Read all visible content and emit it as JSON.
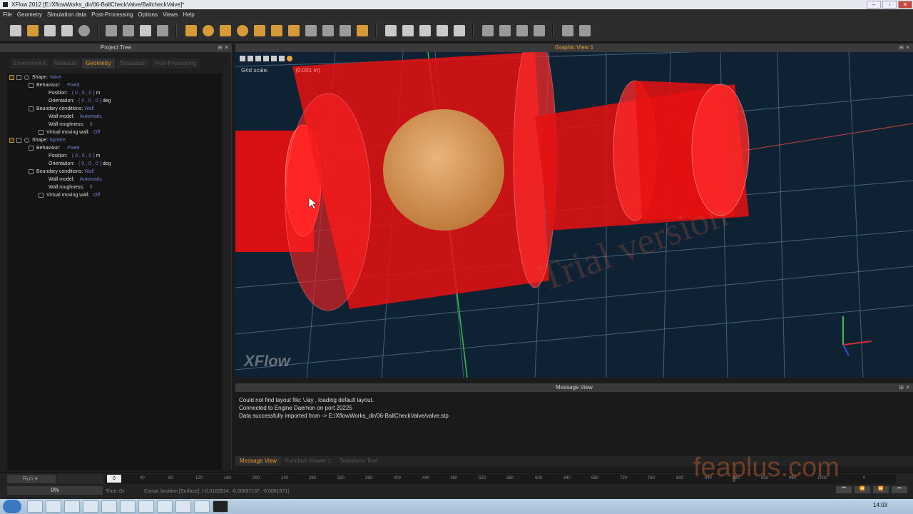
{
  "window": {
    "title": "XFlow 2012 [E:/XflowWorks_dir/06-BallCheckValve/BallcheckValve]*"
  },
  "menu": [
    "File",
    "Geometry",
    "Simulation data",
    "Post-Processing",
    "Options",
    "Views",
    "Help"
  ],
  "project_tree": {
    "title": "Project Tree",
    "tabs": [
      "Environment",
      "Materials",
      "Geometry",
      "Simulation",
      "Post-Processing"
    ],
    "active_tab": "Geometry",
    "shape1": {
      "label": "Shape:",
      "name": "Valve",
      "behaviour_label": "Behaviour:",
      "behaviour": "Fixed",
      "position_label": "Position:",
      "position": "( 0 , 0 , 0 )",
      "position_unit": "m",
      "orientation_label": "Orientation:",
      "orientation": "( 0 , 0 , 0 )",
      "orientation_unit": "deg",
      "bc_label": "Boundary conditions:",
      "bc": "Wall",
      "wall_model_label": "Wall model:",
      "wall_model": "Automatic",
      "wall_rough_label": "Wall roughness:",
      "wall_rough": "0",
      "vmw_label": "Virtual moving wall:",
      "vmw": "Off"
    },
    "shape2": {
      "label": "Shape:",
      "name": "Sphere",
      "behaviour_label": "Behaviour:",
      "behaviour": "Fixed",
      "position_label": "Position:",
      "position": "( 0 , 0 , 0 )",
      "position_unit": "m",
      "orientation_label": "Orientation:",
      "orientation": "( 0 , 0 , 0 )",
      "orientation_unit": "deg",
      "bc_label": "Boundary conditions:",
      "bc": "Wall",
      "wall_model_label": "Wall model:",
      "wall_model": "Automatic",
      "wall_rough_label": "Wall roughness:",
      "wall_rough": "0",
      "vmw_label": "Virtual moving wall:",
      "vmw": "Off"
    }
  },
  "graphic_view": {
    "title": "Graphic View 1",
    "grid_scale_label": "Grid scale:",
    "grid_scale_value": "(0.001 m)",
    "watermark": "Trial version",
    "logo": "XFlow"
  },
  "message_view": {
    "title": "Message View",
    "lines": [
      "Could not find layout file: \\.lay , loading default layout.",
      "Connected to Engine Daemon on port 20225",
      "Data successfully imported from -> E:/XflowWorks_dir/06-BallCheckValve/valve.stp"
    ],
    "tabs": [
      "Message View",
      "Function Viewer 1",
      "Transform Tool"
    ],
    "active_tab": "Message View"
  },
  "timeline": {
    "run_label": "Run",
    "progress": "0%",
    "ticks": [
      "0",
      "40",
      "80",
      "120",
      "160",
      "200",
      "240",
      "280",
      "320",
      "360",
      "400",
      "440",
      "480",
      "520",
      "560",
      "600",
      "640",
      "680",
      "720",
      "760",
      "800",
      "840",
      "880",
      "920",
      "960",
      "1000",
      "0"
    ],
    "time_label": "Time: 0s",
    "cursor": "Cursor location [Surface]: (-0.0162814, -0.00897137, -0.0061971)"
  },
  "overlay_watermark": "feaplus.com",
  "clock": "14:03"
}
